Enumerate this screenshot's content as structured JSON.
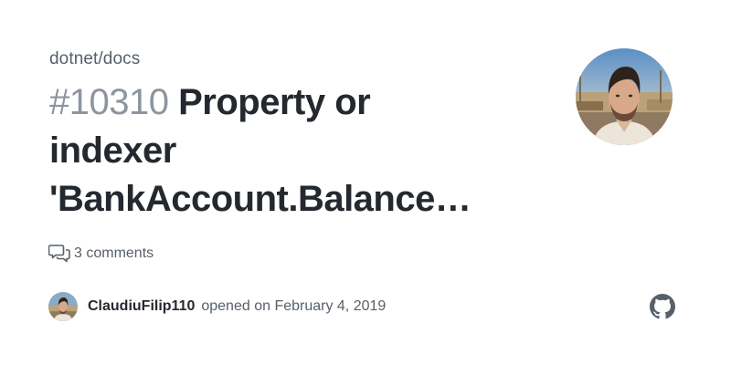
{
  "repo": {
    "name": "dotnet/docs"
  },
  "issue": {
    "number": "#10310",
    "title_line1": "Property or",
    "title_line2": "indexer",
    "title_line3": "'BankAccount.Balance…"
  },
  "comments": {
    "icon": "comment-discussion-icon",
    "text": "3 comments"
  },
  "author": {
    "username": "ClaudiuFilip110",
    "opened_text": "opened on February 4, 2019",
    "avatar": "user-avatar"
  },
  "branding": {
    "logo": "github-mark-icon",
    "logo_color": "#57606a"
  }
}
